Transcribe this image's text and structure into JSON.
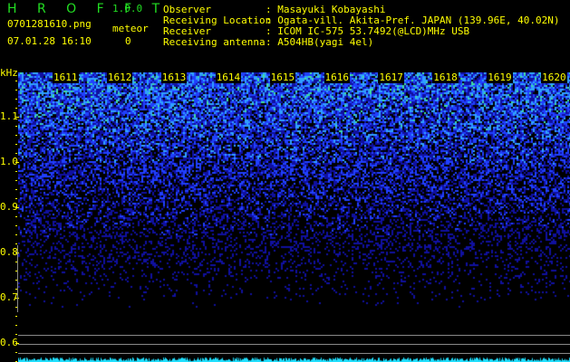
{
  "app": {
    "name": "H R O F F T",
    "version": "1.0.0"
  },
  "file": {
    "name": "0701281610.png",
    "datetime": "07.01.28 16:10"
  },
  "meteor": {
    "label": "meteor",
    "count": "0"
  },
  "info": [
    {
      "key": "Observer",
      "value": ": Masayuki Kobayashi"
    },
    {
      "key": "Receiving Location",
      "value": ": Ogata-vill. Akita-Pref. JAPAN (139.96E, 40.02N)"
    },
    {
      "key": "Receiver",
      "value": ": ICOM IC-575 53.7492(@LCD)MHz USB"
    },
    {
      "key": "Receiving antenna",
      "value": ": A504HB(yagi 4el)"
    }
  ],
  "axis": {
    "unit": "kHz",
    "freq_labels": [
      "1.1",
      "1.0",
      "0.9",
      "0.8",
      "0.7",
      "0.6"
    ],
    "time_labels": [
      "1611",
      "1612",
      "1613",
      "1614",
      "1615",
      "1616",
      "1617",
      "1618",
      "1619",
      "1620"
    ]
  }
}
